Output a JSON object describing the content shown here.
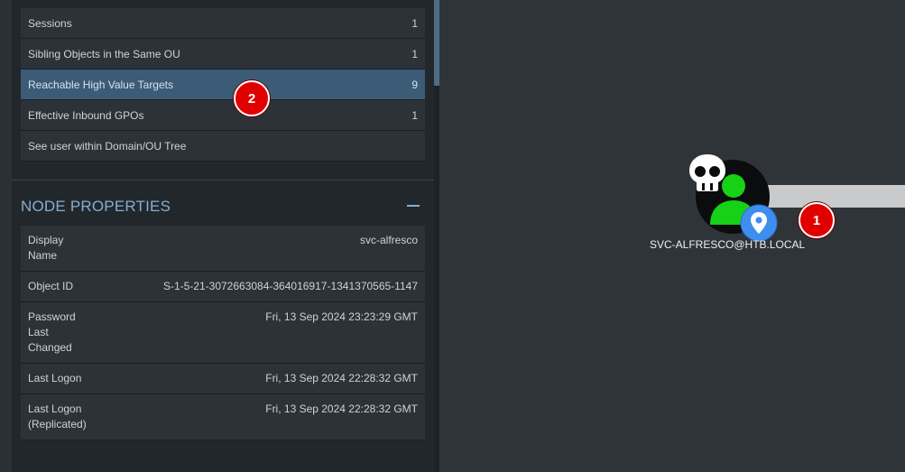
{
  "overview_rows": [
    {
      "label": "Sessions",
      "count": "1"
    },
    {
      "label": "Sibling Objects in the Same OU",
      "count": "1"
    },
    {
      "label": "Reachable High Value Targets",
      "count": "9"
    },
    {
      "label": "Effective Inbound GPOs",
      "count": "1"
    },
    {
      "label": "See user within Domain/OU Tree",
      "count": ""
    }
  ],
  "node_properties": {
    "title": "NODE PROPERTIES",
    "collapse_icon": "minus-icon",
    "rows": [
      {
        "key": "Display Name",
        "value": "svc-alfresco"
      },
      {
        "key": "Object ID",
        "value": "S-1-5-21-3072663084-364016917-1341370565-1147"
      },
      {
        "key": "Password Last Changed",
        "value": "Fri, 13 Sep 2024 23:23:29 GMT"
      },
      {
        "key": "Last Logon",
        "value": "Fri, 13 Sep 2024 22:28:32 GMT"
      },
      {
        "key": "Last Logon (Replicated)",
        "value": "Fri, 13 Sep 2024 22:28:32 GMT"
      }
    ]
  },
  "graph": {
    "node_label": "SVC-ALFRESCO@HTB.LOCAL",
    "node_icons": [
      "user-icon",
      "skull-icon",
      "map-pin-icon"
    ]
  },
  "badges": {
    "one": "1",
    "two": "2"
  },
  "colors": {
    "accent": "#86aed0",
    "active_row": "#3b5b77",
    "user_green": "#17d117",
    "badge_red": "#e00000",
    "pin_blue": "#3e8ef0"
  }
}
